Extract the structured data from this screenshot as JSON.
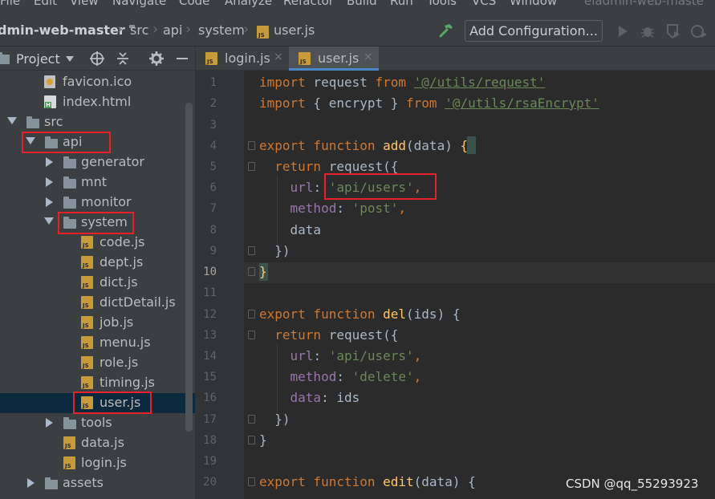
{
  "menu": {
    "items": [
      "File",
      "Edit",
      "View",
      "Navigate",
      "Code",
      "Analyze",
      "Refactor",
      "Build",
      "Run",
      "Tools",
      "VCS",
      "Window"
    ],
    "window_title": "eladmin-web-maste"
  },
  "navbar": {
    "project": "dmin-web-master",
    "crumbs": [
      "src",
      "api",
      "system",
      "user.js"
    ],
    "add_configuration": "Add Configuration..."
  },
  "project_panel": {
    "title": "Project",
    "tree": [
      {
        "label": "favicon.ico",
        "type": "ico"
      },
      {
        "label": "index.html",
        "type": "html"
      },
      {
        "label": "src",
        "type": "folder",
        "expanded": true
      },
      {
        "label": "api",
        "type": "folder",
        "expanded": true
      },
      {
        "label": "generator",
        "type": "folder",
        "expanded": false
      },
      {
        "label": "mnt",
        "type": "folder",
        "expanded": false
      },
      {
        "label": "monitor",
        "type": "folder",
        "expanded": false
      },
      {
        "label": "system",
        "type": "folder",
        "expanded": true
      },
      {
        "label": "code.js",
        "type": "js"
      },
      {
        "label": "dept.js",
        "type": "js"
      },
      {
        "label": "dict.js",
        "type": "js"
      },
      {
        "label": "dictDetail.js",
        "type": "js"
      },
      {
        "label": "job.js",
        "type": "js"
      },
      {
        "label": "menu.js",
        "type": "js"
      },
      {
        "label": "role.js",
        "type": "js"
      },
      {
        "label": "timing.js",
        "type": "js"
      },
      {
        "label": "user.js",
        "type": "js",
        "selected": true
      },
      {
        "label": "tools",
        "type": "folder",
        "expanded": false
      },
      {
        "label": "data.js",
        "type": "js"
      },
      {
        "label": "login.js",
        "type": "js"
      },
      {
        "label": "assets",
        "type": "folder",
        "expanded": false
      }
    ]
  },
  "editor": {
    "tabs": [
      {
        "label": "login.js",
        "close": "×",
        "active": false
      },
      {
        "label": "user.js",
        "close": "×",
        "active": true
      }
    ],
    "line_numbers": [
      "1",
      "2",
      "3",
      "4",
      "5",
      "6",
      "7",
      "8",
      "9",
      "10",
      "11",
      "12",
      "13",
      "14",
      "15",
      "16",
      "17",
      "18",
      "19",
      "20"
    ],
    "current_line": "10",
    "code": {
      "l1_kw": "import",
      "l1_a": " request ",
      "l1_kw2": "from",
      "l1_sp": " ",
      "l1_path": "'@/utils/request'",
      "l2_kw": "import",
      "l2_a": " { encrypt } ",
      "l2_kw2": "from",
      "l2_sp": " ",
      "l2_path": "'@/utils/rsaEncrypt'",
      "l4_kw": "export function ",
      "l4_fn": "add",
      "l4_a": "(data) ",
      "l4_b": "{",
      "l5_kw": "  return ",
      "l5_a": "request({",
      "l6_p": "    url",
      "l6_c": ": ",
      "l6_s": "'api/users'",
      "l6_e": ",",
      "l7_p": "    method",
      "l7_c": ": ",
      "l7_s": "'post'",
      "l7_e": ",",
      "l8": "    data",
      "l9": "  })",
      "l10": "}",
      "l12_kw": "export function ",
      "l12_fn": "del",
      "l12_a": "(ids) {",
      "l13_kw": "  return ",
      "l13_a": "request({",
      "l14_p": "    url",
      "l14_c": ": ",
      "l14_s": "'api/users'",
      "l14_e": ",",
      "l15_p": "    method",
      "l15_c": ": ",
      "l15_s": "'delete'",
      "l15_e": ",",
      "l16_p": "    data",
      "l16_c": ": ids",
      "l17": "  })",
      "l18": "}",
      "l20_kw": "export function ",
      "l20_fn": "edit",
      "l20_a": "(data) {"
    }
  },
  "watermark": "CSDN @qq_55293923",
  "colors": {
    "annotation": "#e8202a",
    "selection": "#0d293e",
    "keyword": "#cc7832",
    "string": "#6a8759",
    "function": "#ffc66d",
    "property": "#9876aa"
  }
}
